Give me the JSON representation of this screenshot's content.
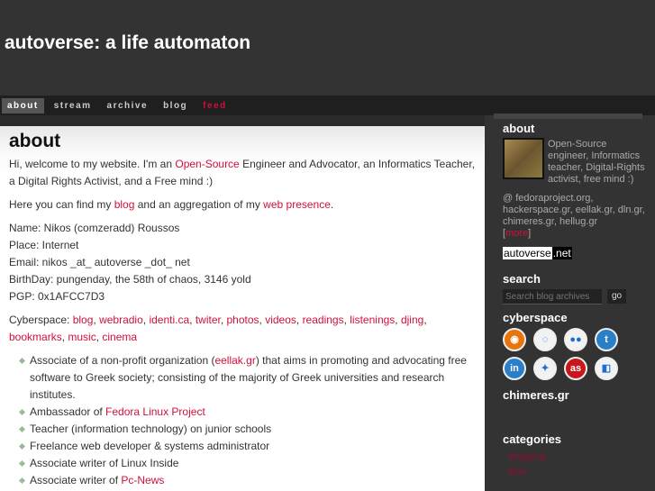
{
  "site_title": "autoverse: a life automaton",
  "nav": [
    {
      "label": "about",
      "active": true
    },
    {
      "label": "stream"
    },
    {
      "label": "archive"
    },
    {
      "label": "blog"
    },
    {
      "label": "feed",
      "feed": true
    }
  ],
  "main": {
    "heading": "about",
    "paragraphs": [
      [
        {
          "t": "Hi, welcome to my website. I'm an "
        },
        {
          "t": "Open-Source",
          "link": true
        },
        {
          "t": " Engineer and Advocator, an Informatics Teacher, a Digital Rights Activist, and a Free mind :)"
        }
      ],
      [
        {
          "t": "Here you can find my "
        },
        {
          "t": "blog",
          "link": true
        },
        {
          "t": " and an aggregation of my "
        },
        {
          "t": "web presence",
          "link": true
        },
        {
          "t": "."
        }
      ],
      [
        {
          "t": "Name: Nikos (comzeradd) Roussos"
        },
        {
          "br": true
        },
        {
          "t": "Place: Internet"
        },
        {
          "br": true
        },
        {
          "t": "Email: nikos _at_ autoverse _dot_ net"
        },
        {
          "br": true
        },
        {
          "t": "BirthDay: pungenday, the 58th of chaos, 3146 yold"
        },
        {
          "br": true
        },
        {
          "t": "PGP: 0x1AFCC7D3"
        }
      ],
      [
        {
          "t": "Cyberspace: "
        },
        {
          "t": "blog",
          "link": true
        },
        {
          "t": ", "
        },
        {
          "t": "webradio",
          "link": true
        },
        {
          "t": ", "
        },
        {
          "t": "identi.ca",
          "link": true
        },
        {
          "t": ", "
        },
        {
          "t": "twiter",
          "link": true
        },
        {
          "t": ", "
        },
        {
          "t": "photos",
          "link": true
        },
        {
          "t": ", "
        },
        {
          "t": "videos",
          "link": true
        },
        {
          "t": ", "
        },
        {
          "t": "readings",
          "link": true
        },
        {
          "t": ", "
        },
        {
          "t": "listenings",
          "link": true
        },
        {
          "t": ", "
        },
        {
          "t": "djing",
          "link": true
        },
        {
          "t": ", "
        },
        {
          "t": "bookmarks",
          "link": true
        },
        {
          "t": ", "
        },
        {
          "t": "music",
          "link": true
        },
        {
          "t": ", "
        },
        {
          "t": "cinema",
          "link": true
        }
      ]
    ],
    "list": [
      [
        {
          "t": "Associate of a non-profit organization ("
        },
        {
          "t": "eellak.gr",
          "link": true
        },
        {
          "t": ") that aims in promoting and advocating free software to Greek society; consisting of the majority of Greek universities and research institutes."
        }
      ],
      [
        {
          "t": "Ambassador of "
        },
        {
          "t": "Fedora Linux Project",
          "link": true
        }
      ],
      [
        {
          "t": "Teacher (information technology) on junior schools"
        }
      ],
      [
        {
          "t": "Freelance web developer & systems administrator"
        }
      ],
      [
        {
          "t": "Associate writer of Linux Inside"
        }
      ],
      [
        {
          "t": "Associate writer of "
        },
        {
          "t": "Pc-News",
          "link": true
        }
      ]
    ]
  },
  "sidebar": {
    "about_title": "about",
    "about_text": "Open-Source engineer, Informatics teacher, Digital-Rights activist, free mind :)",
    "at_text": "@ fedoraproject.org, hackerspace.gr, eellak.gr, dln.gr, chimeres.gr, hellug.gr",
    "more": "more",
    "badge_a": "autoverse",
    "badge_b": ".net",
    "search_title": "search",
    "search_placeholder": "Search blog archives",
    "go": "go",
    "cyberspace_title": "cyberspace",
    "icons": [
      {
        "name": "rss-icon",
        "glyph": "◉",
        "color": "#e8740c"
      },
      {
        "name": "identica-icon",
        "glyph": "◌",
        "color": "#f2f2f2"
      },
      {
        "name": "flickr-icon",
        "glyph": "●●",
        "color": "#f2f2f2"
      },
      {
        "name": "twitter-icon",
        "glyph": "t",
        "color": "#2a7fc8"
      },
      {
        "name": "linkedin-icon",
        "glyph": "in",
        "color": "#2a7fc8"
      },
      {
        "name": "google-buzz-icon",
        "glyph": "✦",
        "color": "#f2f2f2"
      },
      {
        "name": "lastfm-icon",
        "glyph": "as",
        "color": "#c8161d"
      },
      {
        "name": "delicious-icon",
        "glyph": "◧",
        "color": "#f2f2f2"
      }
    ],
    "chimeres_title": "chimeres.gr",
    "categories_title": "categories",
    "categories": [
      "blogging",
      "libre"
    ]
  }
}
